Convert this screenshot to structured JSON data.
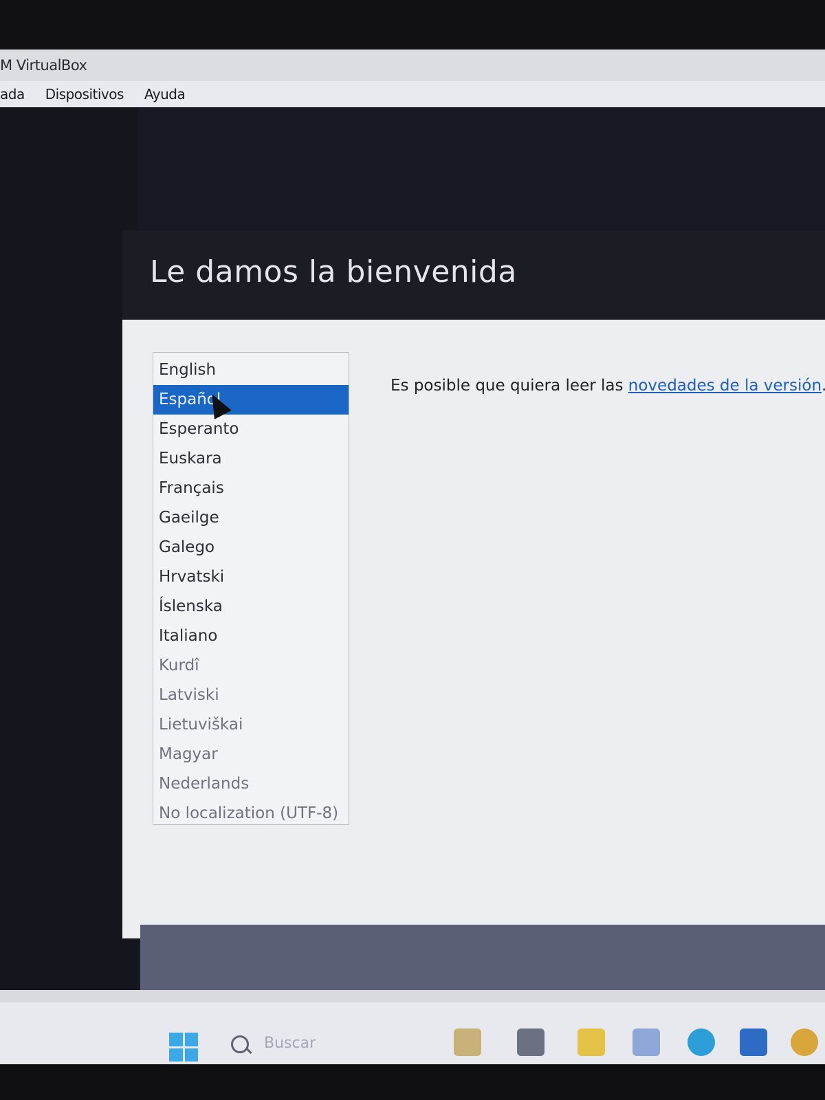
{
  "window": {
    "title": "M VirtualBox"
  },
  "menu": {
    "items": [
      "ada",
      "Dispositivos",
      "Ayuda"
    ]
  },
  "installer": {
    "title": "Le damos la bienvenida",
    "release_note": {
      "text": "Es posible que quiera leer las ",
      "link": "novedades de la versión",
      "suffix": "."
    },
    "languages": [
      "English",
      "Español",
      "Esperanto",
      "Euskara",
      "Français",
      "Gaeilge",
      "Galego",
      "Hrvatski",
      "Íslenska",
      "Italiano",
      "Kurdî",
      "Latviski",
      "Lietuviškai",
      "Magyar",
      "Nederlands",
      "No localization (UTF-8)"
    ],
    "selected_language": "Español"
  },
  "taskbar": {
    "search_placeholder": "Buscar"
  },
  "colors": {
    "selection": "#1a66c5",
    "link": "#1f5fb8",
    "footer": "#5a5f77"
  }
}
